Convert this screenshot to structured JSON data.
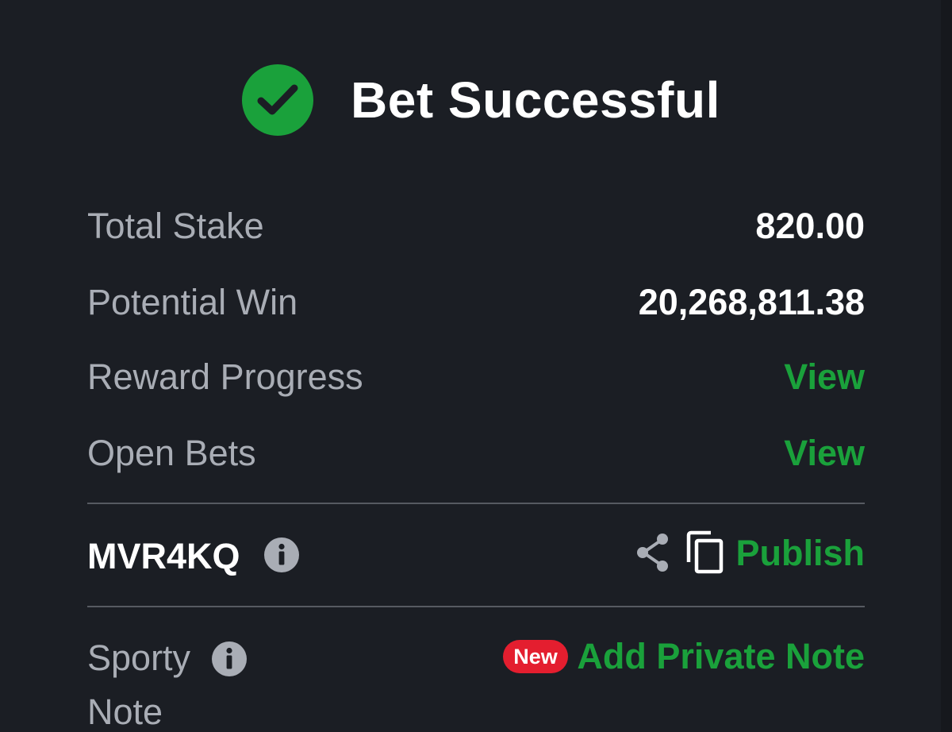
{
  "header": {
    "title": "Bet Successful",
    "success_icon": "check-circle-icon"
  },
  "summary": {
    "total_stake_label": "Total Stake",
    "total_stake_value": "820.00",
    "potential_win_label": "Potential Win",
    "potential_win_value": "20,268,811.38",
    "reward_progress_label": "Reward Progress",
    "reward_progress_link": "View",
    "open_bets_label": "Open Bets",
    "open_bets_link": "View"
  },
  "booking": {
    "code": "MVR4KQ",
    "info_icon": "info-icon",
    "share_icon": "share-icon",
    "copy_icon": "copy-icon",
    "publish_label": "Publish"
  },
  "note": {
    "label_line1": "Sporty",
    "label_line2": "Note",
    "new_badge": "New",
    "add_note_label": "Add Private Note"
  },
  "colors": {
    "background": "#1b1e24",
    "accent_green": "#1aa13b",
    "badge_red": "#e41e2f",
    "label_gray": "#a9adb5"
  }
}
